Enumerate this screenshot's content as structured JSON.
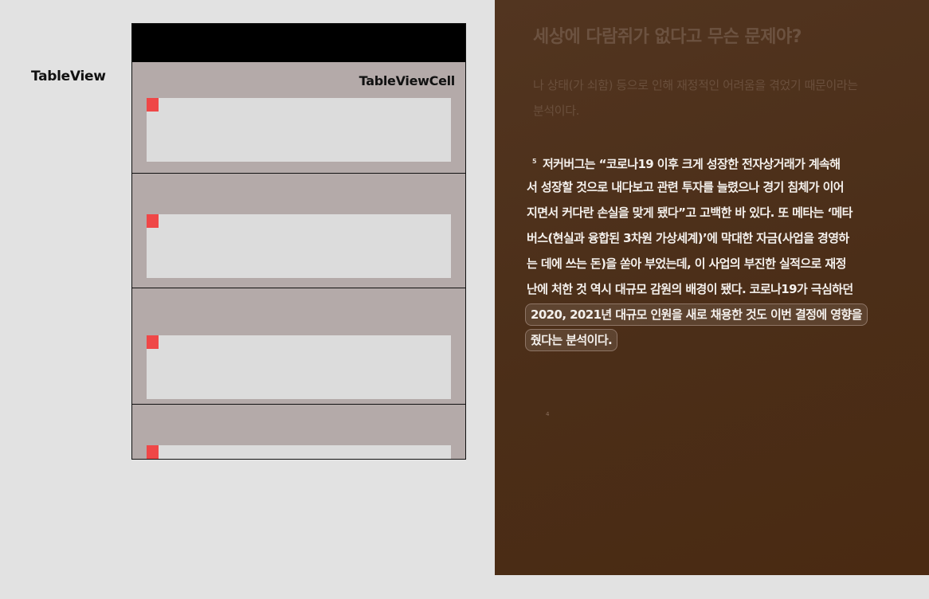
{
  "diagram": {
    "table_view_label": "TableView",
    "cell_label": "TableViewCell",
    "cell_count": 4
  },
  "article": {
    "faded_title": "세상에 다람쥐가 없다고 무슨 문제야?",
    "faded_lines": [
      "나 상태(가 쇠함) 등으로 인해 재정적인 어려움을 겪었기 때문이라는",
      "분석이다."
    ],
    "footnote_number": "5",
    "lines": [
      "저커버그는 “코로나19 이후 크게 성장한 전자상거래가 계속해",
      "서 성장할 것으로 내다보고 관련 투자를 늘렸으나 경기 침체가 이어",
      "지면서 커다란 손실을 맞게 됐다”고 고백한 바 있다. 또 메타는 ‘메타",
      "버스(현실과 융합된 3차원 가상세계)’에 막대한 자금(사업을 경영하",
      "는 데에 쓰는 돈)을 쏟아 부었는데, 이 사업의 부진한 실적으로 재정",
      "난에 처한 것 역시 대규모 감원의 배경이 됐다. 코로나19가 극심하던"
    ],
    "highlighted_lines": [
      "2020, 2021년 대규모 인원을 새로 채용한 것도 이번 결정에 영향을",
      "줬다는 분석이다."
    ],
    "small_mark": "4"
  }
}
